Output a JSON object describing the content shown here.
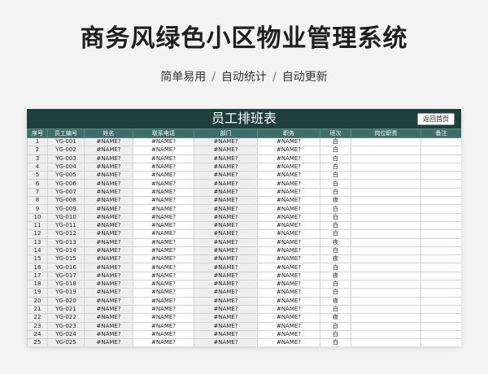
{
  "header": {
    "title": "商务风绿色小区物业管理系统",
    "tags": [
      "简单易用",
      "自动统计",
      "自动更新"
    ],
    "separator": "/"
  },
  "sheet": {
    "title": "员工排班表",
    "back_button": "返回首页",
    "columns": [
      "序号",
      "员工编号",
      "姓名",
      "联系电话",
      "部门",
      "职务",
      "班次",
      "岗位职责",
      "备注"
    ],
    "rows": [
      [
        "1",
        "YG-001",
        "#NAME?",
        "#NAME?",
        "#NAME?",
        "#NAME?",
        "白",
        "",
        ""
      ],
      [
        "2",
        "YG-002",
        "#NAME?",
        "#NAME?",
        "#NAME?",
        "#NAME?",
        "白",
        "",
        ""
      ],
      [
        "3",
        "YG-003",
        "#NAME?",
        "#NAME?",
        "#NAME?",
        "#NAME?",
        "白",
        "",
        ""
      ],
      [
        "4",
        "YG-004",
        "#NAME?",
        "#NAME?",
        "#NAME?",
        "#NAME?",
        "白",
        "",
        ""
      ],
      [
        "5",
        "YG-005",
        "#NAME?",
        "#NAME?",
        "#NAME?",
        "#NAME?",
        "白",
        "",
        ""
      ],
      [
        "6",
        "YG-006",
        "#NAME?",
        "#NAME?",
        "#NAME?",
        "#NAME?",
        "白",
        "",
        ""
      ],
      [
        "7",
        "YG-007",
        "#NAME?",
        "#NAME?",
        "#NAME?",
        "#NAME?",
        "白",
        "",
        ""
      ],
      [
        "8",
        "YG-008",
        "#NAME?",
        "#NAME?",
        "#NAME?",
        "#NAME?",
        "夜",
        "",
        ""
      ],
      [
        "9",
        "YG-009",
        "#NAME?",
        "#NAME?",
        "#NAME?",
        "#NAME?",
        "白",
        "",
        ""
      ],
      [
        "10",
        "YG-010",
        "#NAME?",
        "#NAME?",
        "#NAME?",
        "#NAME?",
        "白",
        "",
        ""
      ],
      [
        "11",
        "YG-011",
        "#NAME?",
        "#NAME?",
        "#NAME?",
        "#NAME?",
        "白",
        "",
        ""
      ],
      [
        "12",
        "YG-012",
        "#NAME?",
        "#NAME?",
        "#NAME?",
        "#NAME?",
        "白",
        "",
        ""
      ],
      [
        "13",
        "YG-013",
        "#NAME?",
        "#NAME?",
        "#NAME?",
        "#NAME?",
        "夜",
        "",
        ""
      ],
      [
        "14",
        "YG-014",
        "#NAME?",
        "#NAME?",
        "#NAME?",
        "#NAME?",
        "白",
        "",
        ""
      ],
      [
        "15",
        "YG-015",
        "#NAME?",
        "#NAME?",
        "#NAME?",
        "#NAME?",
        "夜",
        "",
        ""
      ],
      [
        "16",
        "YG-016",
        "#NAME?",
        "#NAME?",
        "#NAME?",
        "#NAME?",
        "白",
        "",
        ""
      ],
      [
        "17",
        "YG-017",
        "#NAME?",
        "#NAME?",
        "#NAME?",
        "#NAME?",
        "夜",
        "",
        ""
      ],
      [
        "18",
        "YG-018",
        "#NAME?",
        "#NAME?",
        "#NAME?",
        "#NAME?",
        "白",
        "",
        ""
      ],
      [
        "19",
        "YG-019",
        "#NAME?",
        "#NAME?",
        "#NAME?",
        "#NAME?",
        "白",
        "",
        ""
      ],
      [
        "20",
        "YG-020",
        "#NAME?",
        "#NAME?",
        "#NAME?",
        "#NAME?",
        "夜",
        "",
        ""
      ],
      [
        "21",
        "YG-021",
        "#NAME?",
        "#NAME?",
        "#NAME?",
        "#NAME?",
        "白",
        "",
        ""
      ],
      [
        "22",
        "YG-022",
        "#NAME?",
        "#NAME?",
        "#NAME?",
        "#NAME?",
        "夜",
        "",
        ""
      ],
      [
        "23",
        "YG-023",
        "#NAME?",
        "#NAME?",
        "#NAME?",
        "#NAME?",
        "白",
        "",
        ""
      ],
      [
        "24",
        "YG-024",
        "#NAME?",
        "#NAME?",
        "#NAME?",
        "#NAME?",
        "白",
        "",
        ""
      ],
      [
        "25",
        "YG-025",
        "#NAME?",
        "#NAME?",
        "#NAME?",
        "#NAME?",
        "白",
        "",
        ""
      ]
    ]
  },
  "colors": {
    "banner": "#1f3f3d",
    "header_row": "#3d6e68",
    "page_background": "#f3f3f3"
  }
}
